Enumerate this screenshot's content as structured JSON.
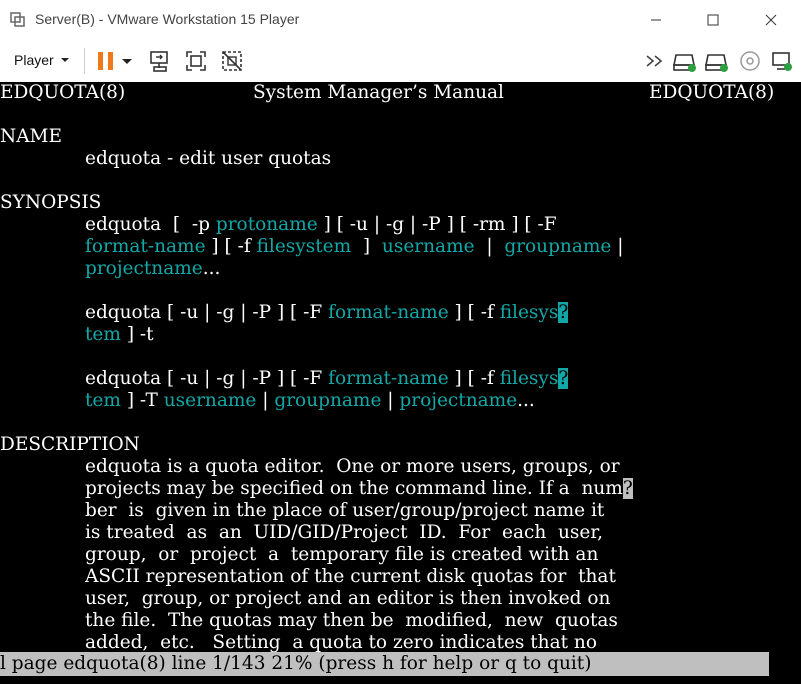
{
  "window": {
    "title": "Server(B) - VMware Workstation 15 Player",
    "minimize_icon": "minimize-icon",
    "maximize_icon": "maximize-icon",
    "close_icon": "close-icon"
  },
  "toolbar": {
    "player_menu_label": "Player",
    "icons": [
      "pause-icon",
      "dropdown-arrow-icon",
      "send-ctrl-alt-del-icon",
      "fullscreen-icon",
      "unity-icon",
      "more-icon",
      "hdd-icon",
      "hdd2-icon",
      "cd-icon",
      "network-icon"
    ]
  },
  "terminal": {
    "header_left": "EDQUOTA(8)",
    "header_center": "System Manager’s Manual",
    "header_right": "EDQUOTA(8)",
    "name_heading": "NAME",
    "name_text": "edquota - edit user quotas",
    "synopsis_heading": "SYNOPSIS",
    "syn1": {
      "a": "edquota  [  -p ",
      "b": "protoname",
      "c": " ] [ -u | -g | -P ] [ -rm ] [ -F"
    },
    "syn2": {
      "a": "format-name",
      "b": " ] [ -f ",
      "c": "filesystem",
      "d": "  ]  ",
      "e": "username",
      "f": "  |  ",
      "g": "groupname",
      "h": " |"
    },
    "syn3": {
      "a": "projectname",
      "b": "..."
    },
    "syn4": {
      "a": "edquota [ -u | -g | -P ] [ -F ",
      "b": "format-name",
      "c": " ] [ -f ",
      "d": "filesys",
      "e": "?"
    },
    "syn5": {
      "a": "tem",
      "b": " ] -t"
    },
    "syn6": {
      "a": "edquota [ -u | -g | -P ] [ -F ",
      "b": "format-name",
      "c": " ] [ -f ",
      "d": "filesys",
      "e": "?"
    },
    "syn7": {
      "a": "tem",
      "b": " ] -T ",
      "c": "username",
      "d": " | ",
      "e": "groupname",
      "f": " | ",
      "g": "projectname",
      "h": "..."
    },
    "description_heading": "DESCRIPTION",
    "desc1": {
      "a": "edquota",
      "b": " is a quota editor.  One or more users, groups, or"
    },
    "desc2": {
      "a": "projects may be specified on the command line. If a  num",
      "b": "?"
    },
    "desc3": "ber  is  given in the place of user/group/project name it",
    "desc4": "is treated  as  an  UID/GID/Project  ID.  For  each  user,",
    "desc5": "group,  or  project  a  temporary file is created with an",
    "desc6": "ASCII representation of the current disk quotas for  that",
    "desc7": "user,  group, or project and an editor is then invoked on",
    "desc8": "the file.  The quotas may then be  modified,  new  quotas",
    "desc9": "added,  etc.   Setting  a quota to zero indicates that no",
    "status": "l page edquota(8) line 1/143 21% (press h for help or q to quit)"
  },
  "colors": {
    "terminal_bg": "#000000",
    "terminal_fg": "#ffffff",
    "highlight": "#13a8a8",
    "status_bg": "#bfbfbf",
    "pause_accent": "#f07a1a"
  }
}
